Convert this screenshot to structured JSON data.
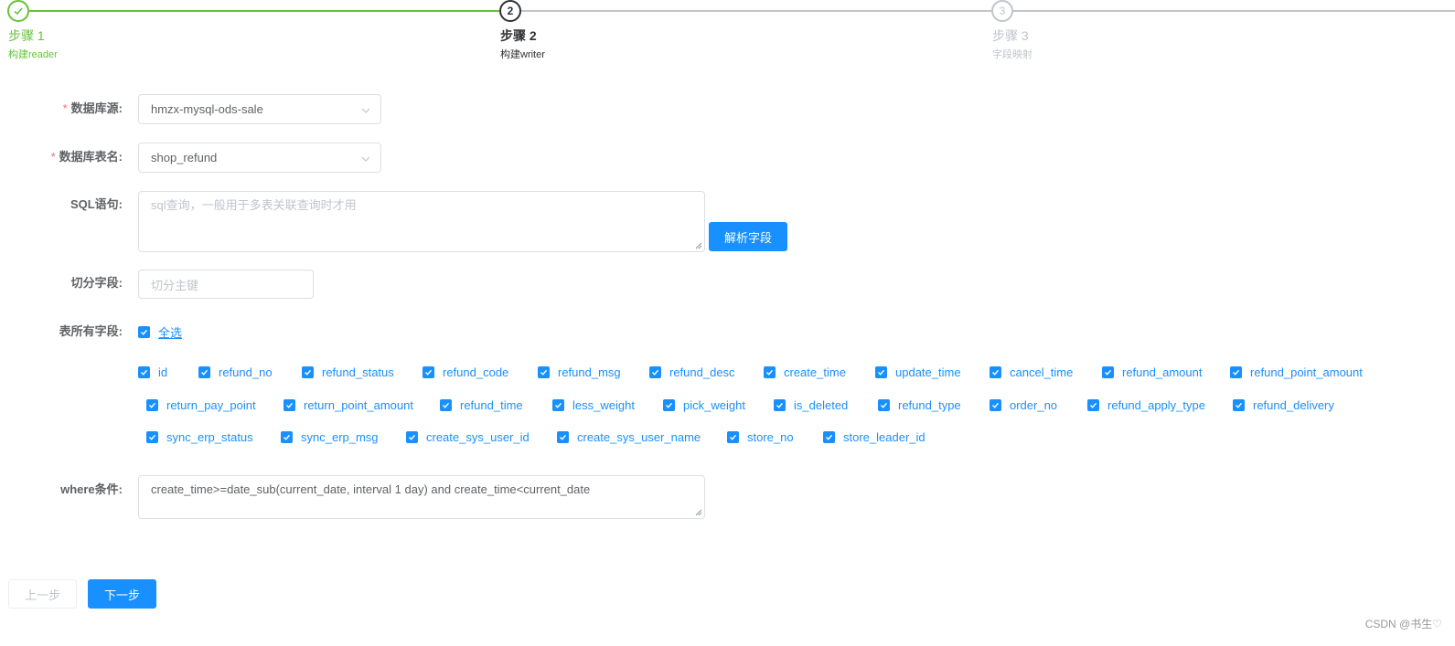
{
  "steps": [
    {
      "title": "步骤 1",
      "desc": "构建reader",
      "status": "success",
      "icon": "check-icon"
    },
    {
      "title": "步骤 2",
      "desc": "构建writer",
      "status": "process",
      "number": "2"
    },
    {
      "title": "步骤 3",
      "desc": "字段映射",
      "status": "wait",
      "number": "3"
    }
  ],
  "form": {
    "datasource": {
      "label": "数据库源:",
      "value": "hmzx-mysql-ods-sale"
    },
    "table": {
      "label": "数据库表名:",
      "value": "shop_refund"
    },
    "sql": {
      "label": "SQL语句:",
      "placeholder": "sql查询，一般用于多表关联查询时才用",
      "parse_button": "解析字段"
    },
    "split": {
      "label": "切分字段:",
      "placeholder": "切分主键"
    },
    "fields": {
      "label": "表所有字段:",
      "select_all": "全选",
      "rows": [
        [
          "id",
          "refund_no",
          "refund_status",
          "refund_code",
          "refund_msg",
          "refund_desc",
          "create_time",
          "update_time",
          "cancel_time",
          "refund_amount",
          "refund_point_amount"
        ],
        [
          "return_pay_point",
          "return_point_amount",
          "refund_time",
          "less_weight",
          "pick_weight",
          "is_deleted",
          "refund_type",
          "order_no",
          "refund_apply_type",
          "refund_delivery"
        ],
        [
          "sync_erp_status",
          "sync_erp_msg",
          "create_sys_user_id",
          "create_sys_user_name",
          "store_no",
          "store_leader_id"
        ]
      ]
    },
    "where": {
      "label": "where条件:",
      "value": "create_time>=date_sub(current_date, interval 1 day) and create_time<current_date"
    }
  },
  "buttons": {
    "prev": "上一步",
    "next": "下一步"
  },
  "watermark": "CSDN @书生♡",
  "colors": {
    "primary": "#1890ff",
    "success": "#67c23a",
    "required": "#f56c6c"
  }
}
